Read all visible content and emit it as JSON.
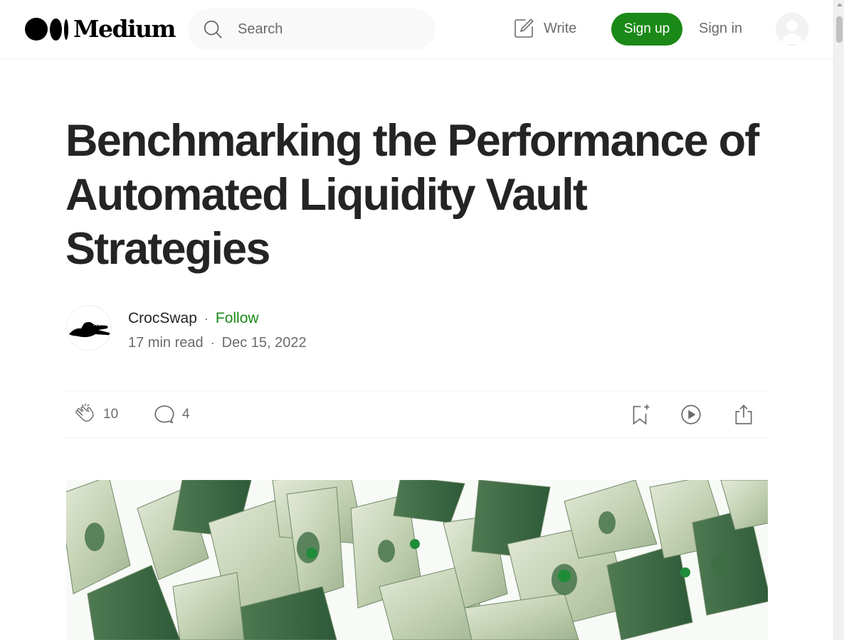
{
  "nav": {
    "logo_text": "Medium",
    "search_placeholder": "Search",
    "write_label": "Write",
    "signup_label": "Sign up",
    "signin_label": "Sign in"
  },
  "article": {
    "title": "Benchmarking the Performance of Automated Liquidity Vault Strategies",
    "author": "CrocSwap",
    "follow_label": "Follow",
    "separator": "·",
    "read_time": "17 min read",
    "date": "Dec 15, 2022"
  },
  "actions": {
    "claps": "10",
    "responses": "4"
  },
  "colors": {
    "accent_green": "#1a8917",
    "text_primary": "#242424",
    "text_secondary": "#6b6b6b"
  },
  "icons": [
    "search-icon",
    "write-icon",
    "user-icon",
    "clap-icon",
    "comment-icon",
    "bookmark-icon",
    "play-icon",
    "share-icon"
  ]
}
